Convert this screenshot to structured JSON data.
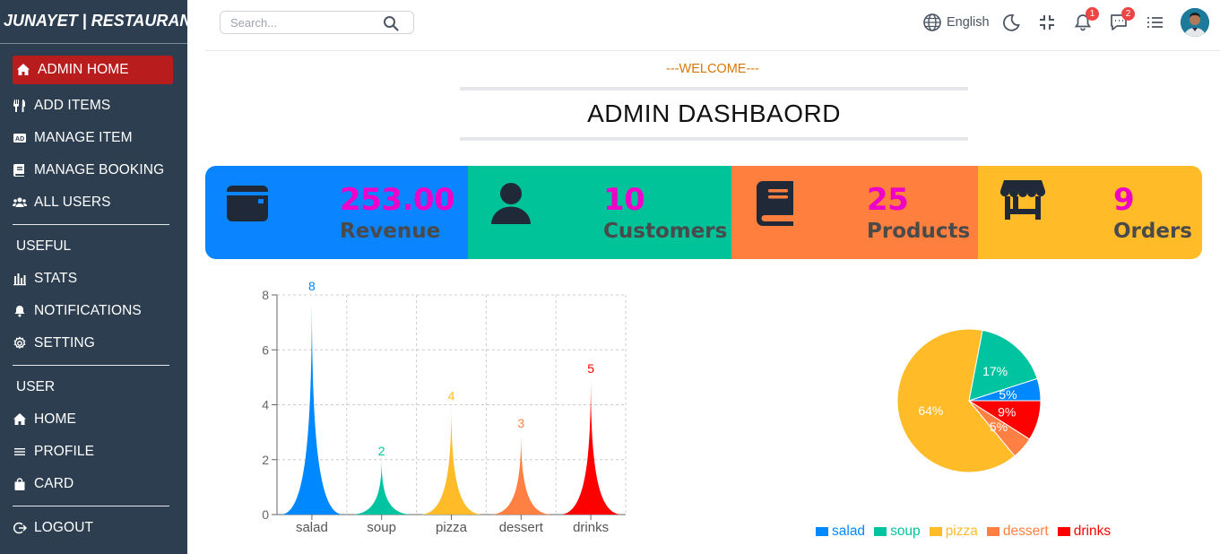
{
  "sidebar": {
    "brand": "JUNAYET | RESTAURANT",
    "items": [
      {
        "label": "ADMIN HOME",
        "icon": "home-icon",
        "active": true
      },
      {
        "label": "ADD ITEMS",
        "icon": "utensils-icon"
      },
      {
        "label": "MANAGE ITEM",
        "icon": "ad-icon"
      },
      {
        "label": "MANAGE BOOKING",
        "icon": "book-icon"
      },
      {
        "label": "ALL USERS",
        "icon": "users-icon"
      }
    ],
    "useful_heading": "USEFUL",
    "useful_items": [
      {
        "label": "STATS",
        "icon": "bar-chart-icon"
      },
      {
        "label": "NOTIFICATIONS",
        "icon": "bell-icon"
      },
      {
        "label": "SETTING",
        "icon": "gear-icon"
      }
    ],
    "user_heading": "USER",
    "user_items": [
      {
        "label": "HOME",
        "icon": "home-icon"
      },
      {
        "label": "PROFILE",
        "icon": "list-icon"
      },
      {
        "label": "CARD",
        "icon": "shopping-bag-icon"
      }
    ],
    "logout": {
      "label": "LOGOUT",
      "icon": "logout-icon"
    }
  },
  "topbar": {
    "search_placeholder": "Search...",
    "language": "English",
    "notification_count": "1",
    "message_count": "2"
  },
  "header": {
    "welcome": "---WELCOME---",
    "title": "ADMIN DASHBAORD"
  },
  "stats": [
    {
      "value": "253.00",
      "label": "Revenue",
      "icon": "calendar-icon",
      "color": "#0a84ff"
    },
    {
      "value": "10",
      "label": "Customers",
      "icon": "user-icon",
      "color": "#00c39a"
    },
    {
      "value": "25",
      "label": "Products",
      "icon": "book-icon",
      "color": "#ff7f3f"
    },
    {
      "value": "9",
      "label": "Orders",
      "icon": "store-icon",
      "color": "#ffbb28"
    }
  ],
  "chart_data": [
    {
      "type": "bar",
      "categories": [
        "salad",
        "soup",
        "pizza",
        "dessert",
        "drinks"
      ],
      "values": [
        8,
        2,
        4,
        3,
        5
      ],
      "colors": [
        "#0088fe",
        "#00c49f",
        "#ffbb28",
        "#ff8042",
        "#ff0000"
      ],
      "ylim": [
        0,
        8
      ],
      "yticks": [
        0,
        2,
        4,
        6,
        8
      ],
      "grid": true,
      "bar_shape": "triangle-spike"
    },
    {
      "type": "pie",
      "categories": [
        "salad",
        "soup",
        "pizza",
        "dessert",
        "drinks"
      ],
      "values": [
        5,
        17,
        64,
        5,
        9
      ],
      "labels": [
        "5%",
        "17%",
        "64%",
        "5%",
        "9%"
      ],
      "colors": [
        "#0088fe",
        "#00c49f",
        "#ffbb28",
        "#ff8042",
        "#ff0000"
      ],
      "legend": "bottom"
    }
  ]
}
